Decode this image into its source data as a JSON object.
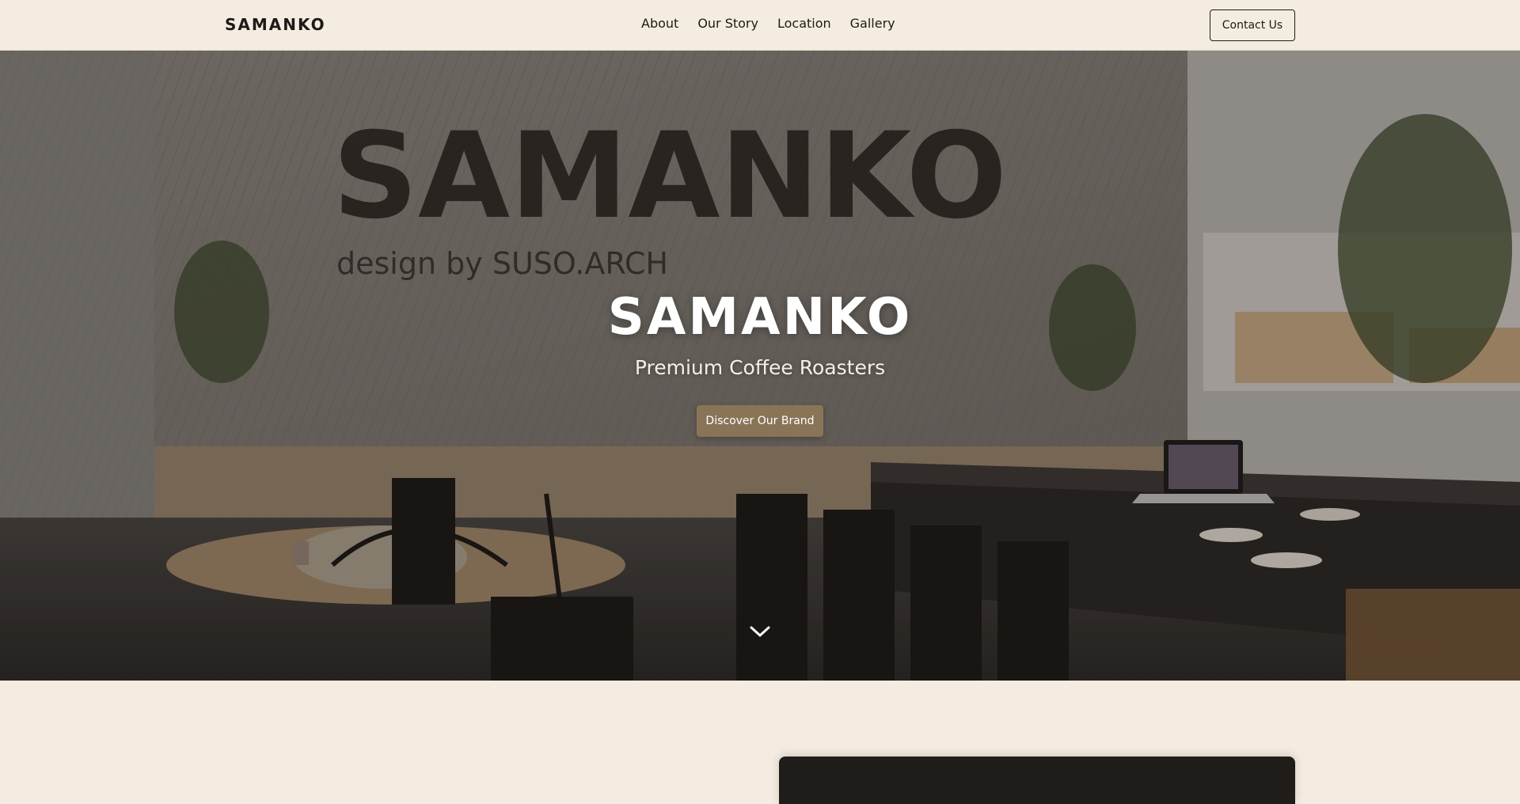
{
  "nav": {
    "brand": "SAMANKO",
    "links": [
      "About",
      "Our Story",
      "Location",
      "Gallery"
    ],
    "contact_label": "Contact Us"
  },
  "hero": {
    "wall_sign": "SAMANKO",
    "wall_sign_credit": "design by SUSO.ARCH",
    "title": "SAMANKO",
    "subtitle": "Premium Coffee Roasters",
    "cta_label": "Discover Our Brand",
    "scroll_icon": "chevron-down-icon"
  },
  "colors": {
    "background": "#f4ece0",
    "accent": "#8a7458",
    "text": "#1c1a17"
  }
}
